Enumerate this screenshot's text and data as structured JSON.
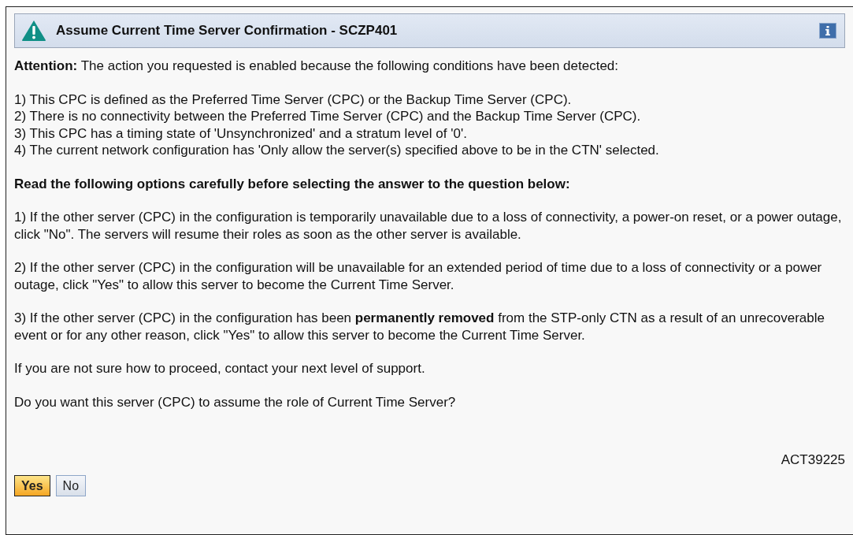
{
  "window": {
    "title": "Assume Current Time Server Confirmation - SCZP401"
  },
  "intro": "**Attention:** The action you requested is enabled because the following conditions have been detected:",
  "conditions": [
    "1) This CPC is defined as the Preferred Time Server (CPC) or the Backup Time Server (CPC).",
    "2) There is no connectivity between the Preferred Time Server (CPC) and the Backup Time Server (CPC).",
    "3) This CPC has a timing state of 'Unsynchronized' and a stratum level of '0'.",
    "4) The current network configuration has 'Only allow the server(s) specified above to be in the CTN' selected."
  ],
  "options_heading": "Read the following options carefully before selecting the answer to the question below:",
  "options": [
    "1) If the other server (CPC) in the configuration is temporarily unavailable due to a loss of connectivity, a power-on reset, or a power outage, click \"No\". The servers will resume their roles as soon as the other server is available.",
    "2) If the other server (CPC) in the configuration will be unavailable for an extended period of time due to a loss of connectivity or a power outage, click \"Yes\" to allow this server to become the Current Time Server.",
    "3) If the other server (CPC) in the configuration has been **permanently removed** from the STP-only CTN as a result of an unrecoverable event or for any other reason, click \"Yes\" to allow this server to become the Current Time Server."
  ],
  "support_note": "If you are not sure how to proceed, contact your next level of support.",
  "question": "Do you want this server (CPC) to assume the role of Current Time Server?",
  "message_id": "ACT39225",
  "buttons": [
    {
      "label": "Yes",
      "kind": "default"
    },
    {
      "label": "No",
      "kind": "normal"
    }
  ]
}
